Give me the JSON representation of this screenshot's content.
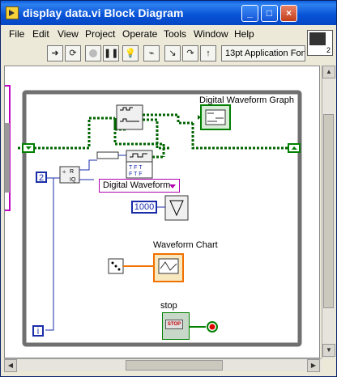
{
  "window": {
    "title": "display data.vi Block Diagram",
    "controls": [
      "_",
      "□",
      "×"
    ]
  },
  "menu": [
    "File",
    "Edit",
    "View",
    "Project",
    "Operate",
    "Tools",
    "Window",
    "Help"
  ],
  "toolbar": {
    "font": "13pt Application Font",
    "vi_icon_number": "2"
  },
  "diagram": {
    "graph_label": "Digital Waveform Graph",
    "chart_label": "Waveform Chart",
    "stop_label": "stop",
    "ring_value": "Digital Waveform",
    "const_two": "2",
    "const_thousand": "1000",
    "iteration": "i",
    "stop_face": "STOP",
    "quotient_label": "R\nIQ"
  },
  "colors": {
    "loop_border": "#707070",
    "digital_wire": "#008000",
    "int_wire": "#1a2ca8",
    "ring_border": "#b000b0"
  }
}
